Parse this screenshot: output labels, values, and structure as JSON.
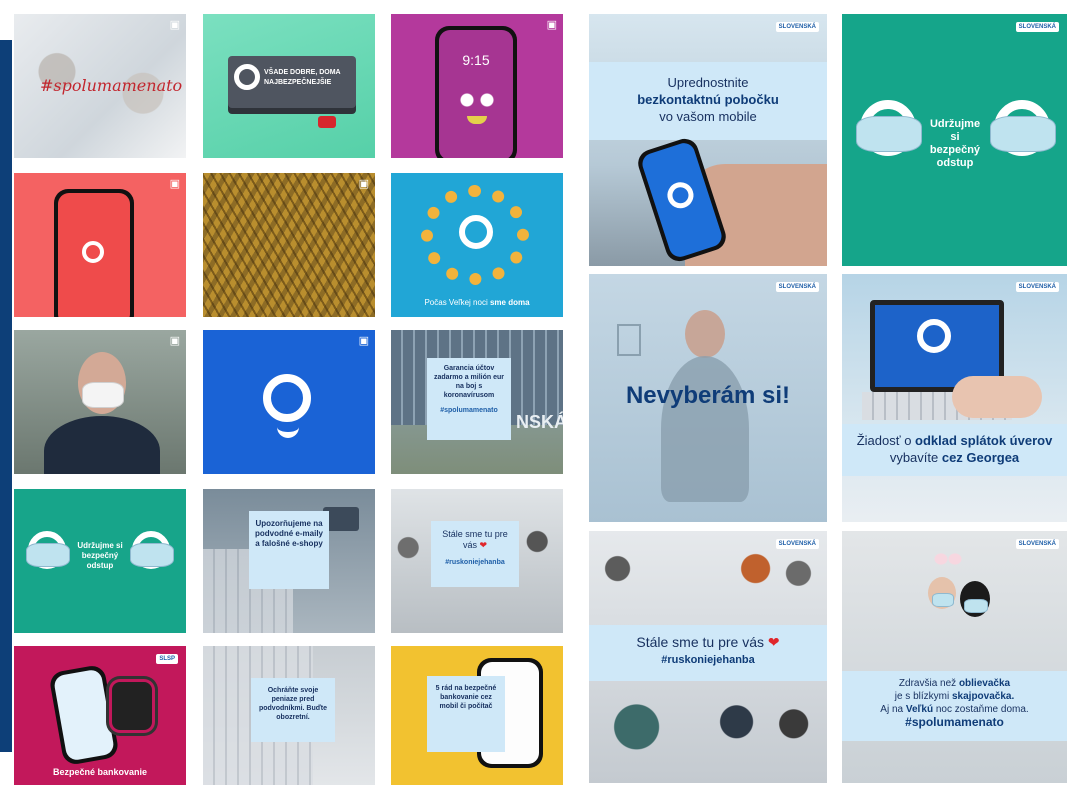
{
  "left_grid": {
    "row1": {
      "hashtag_script": "#spolumamenato",
      "sign_text": "VŠADE DOBRE, DOMA NAJBEZPEČNEJŠIE",
      "phone_time": "9:15"
    },
    "row3": {
      "guarantee_text": "Garancia účtov zadarmo a milión eur na boj s koronavírusom",
      "guarantee_hashtag": "#spolumamenato",
      "building_text": "NSKÁ"
    },
    "row2": {
      "easter_caption_plain": "Počas Veľkej noci ",
      "easter_caption_bold": "sme doma"
    },
    "row4": {
      "distance_text": "Udržujme si bezpečný odstup",
      "phishing_text": "Upozorňujeme na podvodné e-maily a falošné e-shopy",
      "staff_text": "Stále sme tu pre vás",
      "staff_heart": "❤",
      "staff_hashtag": "#ruskoniejehanba"
    },
    "row5": {
      "safe_banking": "Bezpečné bankovanie",
      "brand_badge": "SLSP",
      "scam_text": "Ochráňte svoje peniaze pred podvodníkmi. Buďte obozretní.",
      "rules_text": "5 rád na bezpečné bankovanie cez mobil či počítač"
    }
  },
  "right_grid": {
    "brand_label": "SLOVENSKÁ",
    "contactless": {
      "line1": "Uprednostnite",
      "bold": "bezkontaktnú pobočku",
      "line3": "vo vašom mobile"
    },
    "distance": {
      "text": "Udržujme si bezpečný odstup"
    },
    "choosy": {
      "text": "Nevyberám si!"
    },
    "loan": {
      "line1_plain": "Žiadosť o ",
      "line1_bold": "odklad splátok úverov",
      "line2_plain": "vybavíte ",
      "line2_bold": "cez Georgea"
    },
    "staff": {
      "text": "Stále sme tu pre vás",
      "heart": "❤",
      "hashtag": "#ruskoniejehanba"
    },
    "easter": {
      "line1_plain": "Zdravšia než ",
      "line1_bold": "oblievačka",
      "line2_plain": "je s blízkymi ",
      "line2_bold": "skajpovačka.",
      "line3_plain": "Aj na ",
      "line3_bold": "Veľkú",
      "line3_rest": " noc zostaňme doma.",
      "hashtag": "#spolumamenato"
    }
  }
}
